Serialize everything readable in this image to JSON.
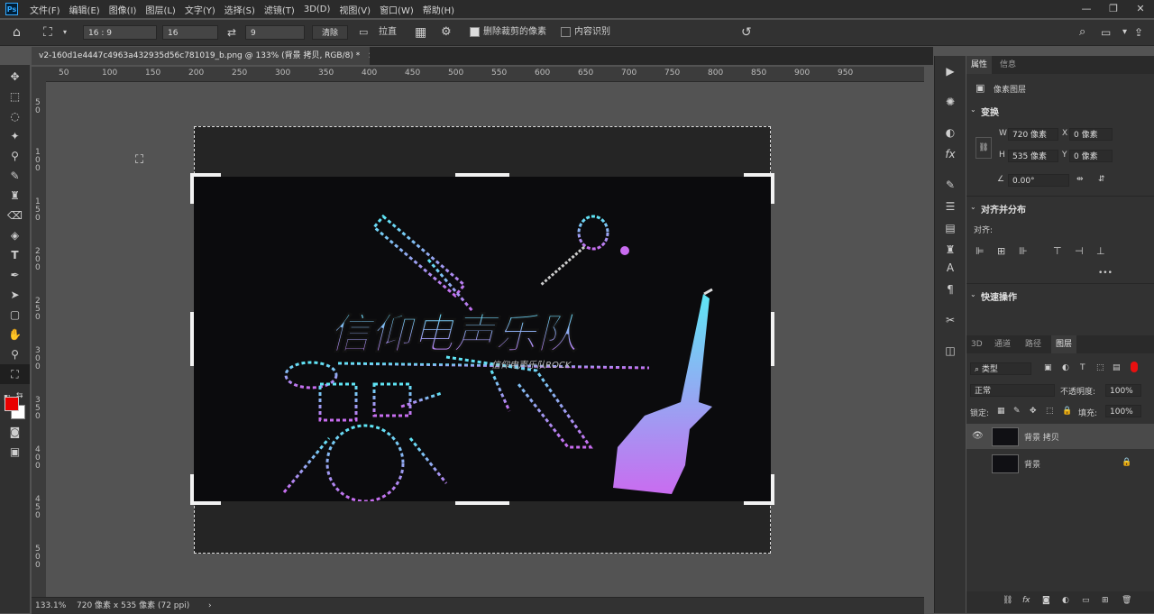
{
  "menu": [
    "文件(F)",
    "编辑(E)",
    "图像(I)",
    "图层(L)",
    "文字(Y)",
    "选择(S)",
    "滤镜(T)",
    "3D(D)",
    "视图(V)",
    "窗口(W)",
    "帮助(H)"
  ],
  "logo": "Ps",
  "window_controls": {
    "minimize": "—",
    "restore": "❐",
    "close": "✕"
  },
  "options": {
    "ratio_value": "16 : 9",
    "width_value": "16",
    "height_value": "9",
    "clear_label": "清除",
    "straighten_label": "拉直",
    "delete_cropped_label": "删除裁剪的像素",
    "delete_cropped_checked": true,
    "content_aware_label": "内容识别",
    "content_aware_checked": false
  },
  "document_tab": {
    "title": "v2-160d1e4447c4963a432935d56c781019_b.png @ 133% (背景 拷贝, RGB/8) *",
    "close": "×"
  },
  "ruler_h_labels": [
    "50",
    "100",
    "150",
    "200",
    "250",
    "300",
    "350",
    "400",
    "450",
    "500",
    "550",
    "600",
    "650",
    "700",
    "750",
    "800",
    "850",
    "900",
    "950"
  ],
  "ruler_v_labels": [
    "5 0",
    "1 0 0",
    "1 5 0",
    "2 0 0",
    "2 5 0",
    "3 0 0",
    "3 5 0",
    "4 0 0",
    "4 5 0",
    "5 0 0"
  ],
  "canvas_art": {
    "title_text": "信仰电声乐队",
    "subtitle_text": "信仰电声乐队ROCK"
  },
  "status": {
    "zoom": "133.1%",
    "doc_info": "720 像素 x 535 像素 (72 ppi)"
  },
  "properties_panel": {
    "tabs": [
      "属性",
      "信息"
    ],
    "layer_type": "像素图层",
    "transform_title": "变换",
    "w_label": "W",
    "w_value": "720 像素",
    "h_label": "H",
    "h_value": "535 像素",
    "x_label": "X",
    "x_value": "0 像素",
    "y_label": "Y",
    "y_value": "0 像素",
    "angle_value": "0.00°",
    "align_title": "对齐并分布",
    "align_label": "对齐:",
    "more": "•••",
    "quick_actions_title": "快速操作"
  },
  "layers_panel": {
    "tabs": [
      "3D",
      "通道",
      "路径",
      "图层"
    ],
    "filter_kind": "类型",
    "blend_mode": "正常",
    "opacity_label": "不透明度:",
    "opacity_value": "100%",
    "lock_label": "锁定:",
    "fill_label": "填充:",
    "fill_value": "100%",
    "layers": [
      {
        "name": "背景 拷贝",
        "visible": true,
        "selected": true,
        "locked": false
      },
      {
        "name": "背景",
        "visible": false,
        "selected": false,
        "locked": true
      }
    ]
  },
  "colors": {
    "foreground": "#e80000",
    "background": "#ffffff",
    "accent_cyan": "#5ee6f5",
    "accent_purple": "#c96cf0"
  }
}
